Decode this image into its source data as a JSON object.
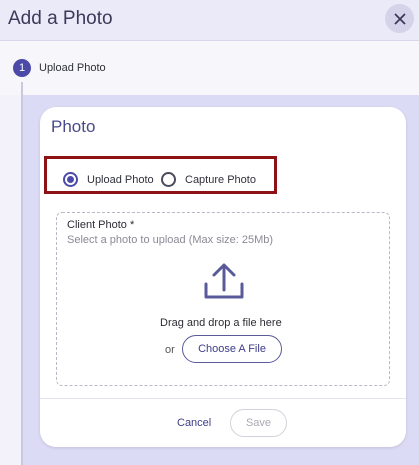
{
  "dialog": {
    "title": "Add a Photo",
    "close_icon": "close-icon"
  },
  "stepper": {
    "step_number": "1",
    "step_label": "Upload Photo"
  },
  "card": {
    "title": "Photo",
    "options": [
      {
        "label": "Upload Photo",
        "selected": true
      },
      {
        "label": "Capture Photo",
        "selected": false
      }
    ],
    "field_label": "Client Photo *",
    "field_helper": "Select a photo to upload (Max size: 25Mb)",
    "upload_icon": "upload-icon",
    "drag_text": "Drag and drop a file here",
    "or_text": "or",
    "choose_button": "Choose A File",
    "cancel_button": "Cancel",
    "save_button": "Save"
  },
  "colors": {
    "accent": "#4c4aa8",
    "highlight": "#8f1118",
    "background": "#dcdbf5"
  }
}
